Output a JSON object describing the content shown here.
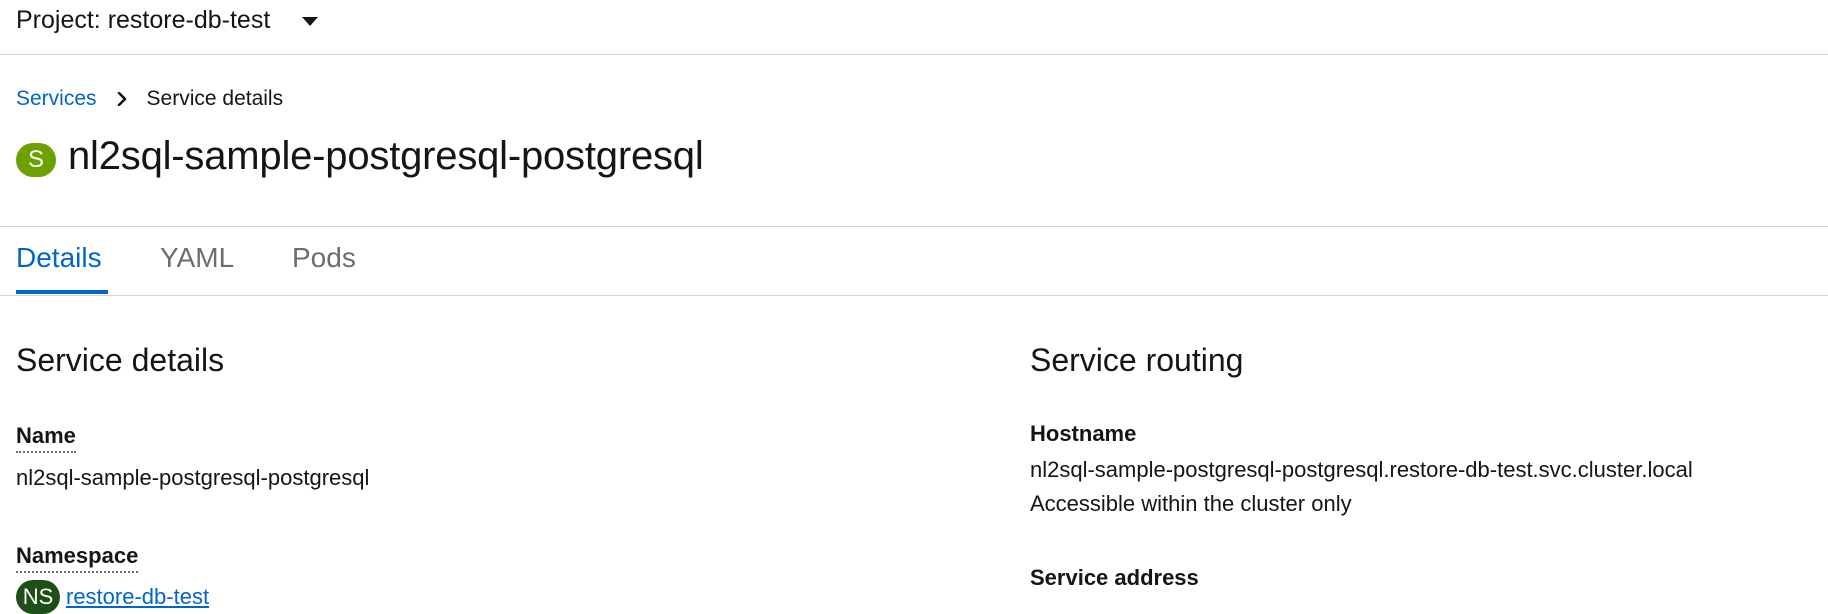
{
  "project": {
    "label": "Project: restore-db-test"
  },
  "breadcrumb": {
    "parent": "Services",
    "current": "Service details"
  },
  "resource": {
    "badge": "S",
    "title": "nl2sql-sample-postgresql-postgresql",
    "badge_color": "#6ca100"
  },
  "tabs": [
    {
      "label": "Details",
      "active": true
    },
    {
      "label": "YAML",
      "active": false
    },
    {
      "label": "Pods",
      "active": false
    }
  ],
  "service_details": {
    "heading": "Service details",
    "name_label": "Name",
    "name_value": "nl2sql-sample-postgresql-postgresql",
    "namespace_label": "Namespace",
    "namespace_badge": "NS",
    "namespace_value": "restore-db-test"
  },
  "service_routing": {
    "heading": "Service routing",
    "hostname_label": "Hostname",
    "hostname_value": "nl2sql-sample-postgresql-postgresql.restore-db-test.svc.cluster.local",
    "hostname_note": "Accessible within the cluster only",
    "address_label": "Service address"
  },
  "colors": {
    "link": "#0066cc",
    "active_tab": "#0066cc",
    "namespace_badge": "#1e4f18"
  }
}
